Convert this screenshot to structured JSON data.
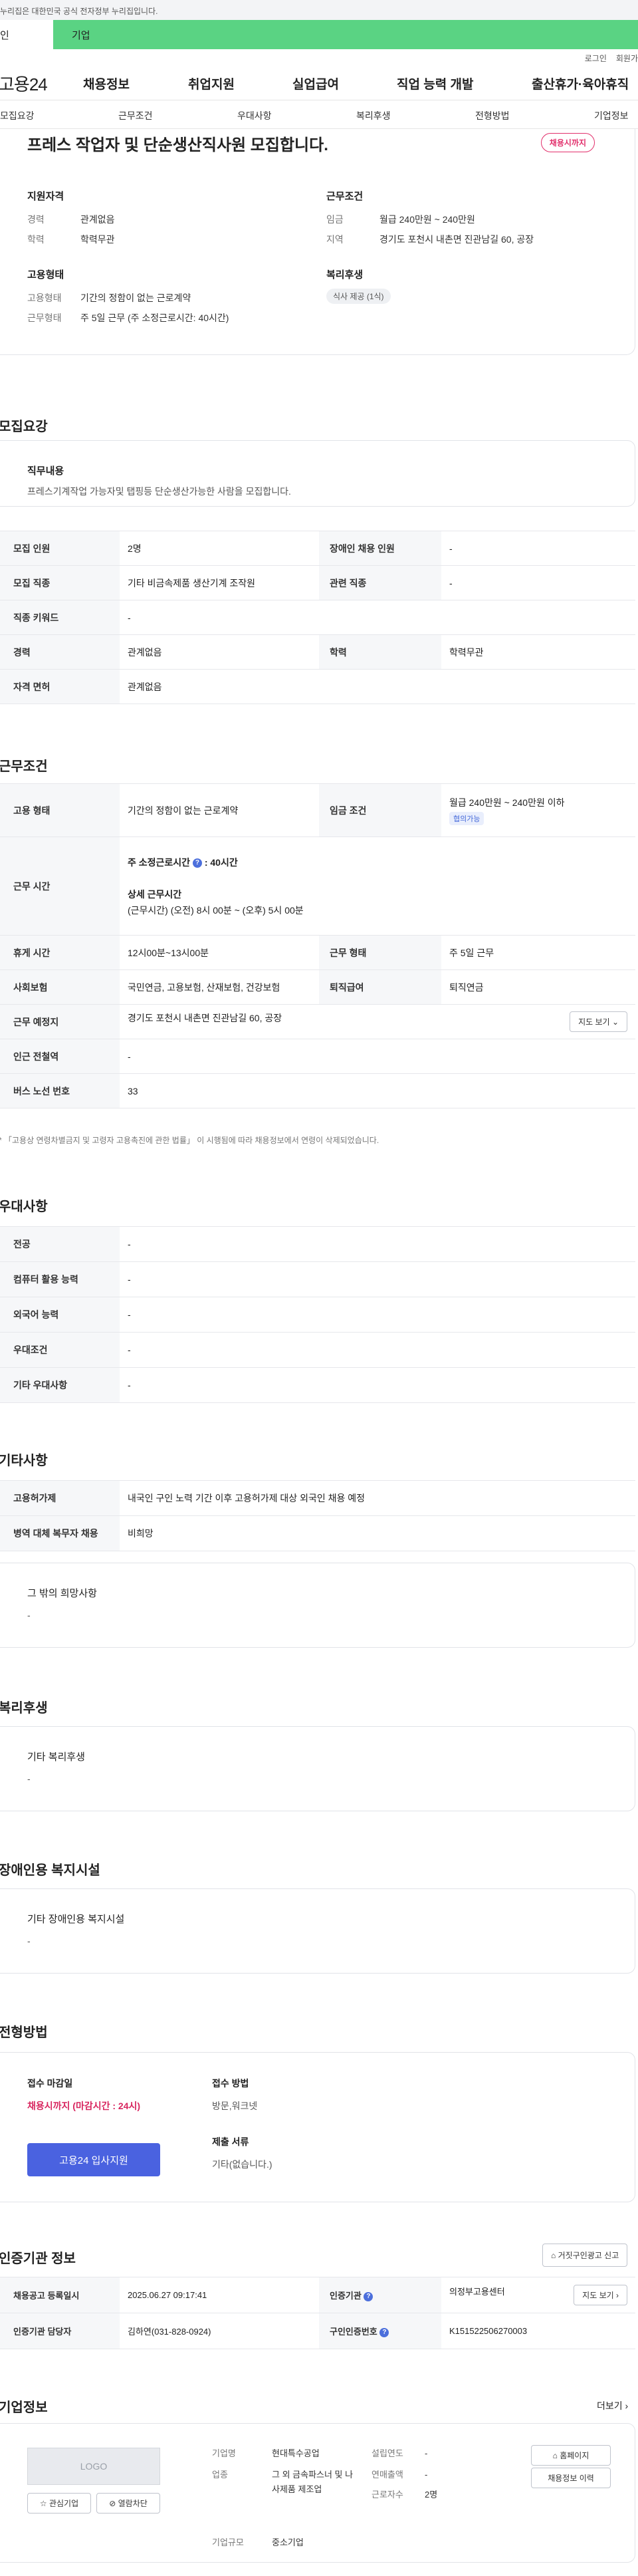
{
  "gov_notice": "누리집은 대한민국 공식 전자정부 누리집입니다.",
  "top_tabs": [
    "인",
    "기업"
  ],
  "util": [
    "로그인",
    "회원가"
  ],
  "logo": "고용24",
  "gnb": [
    "채용정보",
    "취업지원",
    "실업급여",
    "직업 능력 개발",
    "출산휴가·육아휴직"
  ],
  "lnb": [
    "모집요강",
    "근무조건",
    "우대사항",
    "복리후생",
    "전형방법",
    "기업정보"
  ],
  "job": {
    "title": "프레스 작업자 및 단순생산직사원 모집합니다.",
    "status_badge": "채용시까지",
    "qual_heading": "지원자격",
    "qual": [
      {
        "k": "경력",
        "v": "관계없음"
      },
      {
        "k": "학력",
        "v": "학력무관"
      }
    ],
    "work_heading": "근무조건",
    "work": [
      {
        "k": "임금",
        "v": "월급 240만원 ~ 240만원"
      },
      {
        "k": "지역",
        "v": "경기도 포천시 내촌면 진관남길 60, 공장"
      }
    ],
    "emp_heading": "고용형태",
    "emp": [
      {
        "k": "고용형태",
        "v": "기간의 정함이 없는 근로계약"
      },
      {
        "k": "근무형태",
        "v": "주 5일 근무 (주 소정근로시간: 40시간)"
      }
    ],
    "welfare_heading": "복리후생",
    "welfare_chip": "식사 제공 (1식)"
  },
  "recruit": {
    "heading": "모집요강",
    "duty_title": "직무내용",
    "duty_desc": "프레스기계작업 가능자및 탭핑등 단순생산가능한 사람을 모집합니다.",
    "rows": [
      {
        "k1": "모집 인원",
        "v1": "2명",
        "k2": "장애인 채용 인원",
        "v2": "-"
      },
      {
        "k1": "모집 직종",
        "v1": "기타 비금속제품 생산기계 조작원",
        "k2": "관련 직종",
        "v2": "-"
      },
      {
        "k1": "직종 키워드",
        "v1": "-"
      },
      {
        "k1": "경력",
        "v1": "관계없음",
        "k2": "학력",
        "v2": "학력무관"
      },
      {
        "k1": "자격 면허",
        "v1": "관계없음"
      }
    ]
  },
  "work": {
    "heading": "근무조건",
    "emp_type_k": "고용 형태",
    "emp_type_v": "기간의 정함이 없는 근로계약",
    "wage_k": "임금 조건",
    "wage_v": "월급 240만원 ~ 240만원 이하",
    "wage_tag": "협의가능",
    "hours_k": "근무 시간",
    "hours_week_label": "주 소정근로시간",
    "hours_week_value": ": 40시간",
    "hours_detail_label": "상세 근무시간",
    "hours_detail_value": "(근무시간) (오전) 8시 00분 ~ (오후) 5시 00분",
    "break_k": "휴게 시간",
    "break_v": "12시00분~13시00분",
    "shape_k": "근무 형태",
    "shape_v": "주 5일 근무",
    "ins_k": "사회보험",
    "ins_v": "국민연금, 고용보험, 산재보험, 건강보험",
    "ret_k": "퇴직급여",
    "ret_v": "퇴직연금",
    "place_k": "근무 예정지",
    "place_v": "경기도 포천시 내촌면 진관남길 60, 공장",
    "map_btn": "지도 보기",
    "station_k": "인근 전철역",
    "station_v": "-",
    "bus_k": "버스 노선 번호",
    "bus_v": "33",
    "note": "* 「고용상 연령차별금지 및 고령자 고용촉진에 관한 법률」 이 시행됨에 따라 채용정보에서 연령이 삭제되었습니다."
  },
  "pref": {
    "heading": "우대사항",
    "rows": [
      {
        "k": "전공",
        "v": "-"
      },
      {
        "k": "컴퓨터 활용 능력",
        "v": "-"
      },
      {
        "k": "외국어 능력",
        "v": "-"
      },
      {
        "k": "우대조건",
        "v": "-"
      },
      {
        "k": "기타 우대사항",
        "v": "-"
      }
    ]
  },
  "etc": {
    "heading": "기타사항",
    "rows": [
      {
        "k": "고용허가제",
        "v": "내국인 구인 노력 기간 이후 고용허가제 대상 외국인 채용 예정"
      },
      {
        "k": "병역 대체 복무자 채용",
        "v": "비희망"
      }
    ],
    "wish_title": "그 밖의 희망사항",
    "wish_v": "-"
  },
  "welfare": {
    "heading": "복리후생",
    "title": "기타 복리후생",
    "v": "-"
  },
  "disab": {
    "heading": "장애인용 복지시설",
    "title": "기타 장애인용 복지시설",
    "v": "-"
  },
  "select": {
    "heading": "전형방법",
    "deadline_label": "접수 마감일",
    "deadline_v": "채용시까지 (마감시간 : 24시)",
    "apply_btn": "고용24 입사지원",
    "method_label": "접수 방법",
    "method_v": "방문,워크넷",
    "docs_label": "제출 서류",
    "docs_v": "기타(없습니다.)"
  },
  "cert": {
    "heading": "인증기관 정보",
    "report_btn": "거짓구인광고 신고",
    "r1_k1": "채용공고 등록일시",
    "r1_v1": "2025.06.27 09:17:41",
    "r1_k2": "인증기관",
    "r1_v2": "의정부고용센터",
    "map_btn": "지도 보기",
    "r2_k1": "인증기관 담당자",
    "r2_v1": "김하연(031-828-0924)",
    "r2_k2": "구인인증번호",
    "r2_v2": "K151522506270003"
  },
  "company": {
    "heading": "기업정보",
    "more": "더보기",
    "logo": "LOGO",
    "fav_btn": "관심기업",
    "block_btn": "열람차단",
    "f1_k": "기업명",
    "f1_v": "현대특수공업",
    "f2_k": "업종",
    "f2_v": "그 외 금속파스너 및 나사제품 제조업",
    "f3_k": "기업규모",
    "f3_v": "중소기업",
    "f4_k": "설립연도",
    "f4_v": "-",
    "f5_k": "연매출액",
    "f5_v": "-",
    "f6_k": "근로자수",
    "f6_v": "2명",
    "home_btn": "홈페이지",
    "history_btn": "채용정보 이력"
  }
}
